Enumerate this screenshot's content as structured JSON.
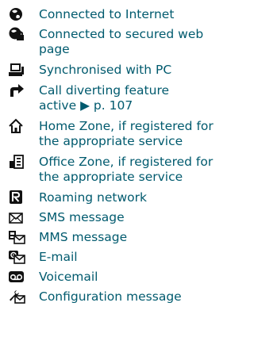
{
  "entries": [
    {
      "icon": "globe-connected-icon",
      "text": "Connected to Internet"
    },
    {
      "icon": "secured-globe-icon",
      "text": "Connected to secured web\npage"
    },
    {
      "icon": "pc-sync-icon",
      "text": "Synchronised with PC"
    },
    {
      "icon": "call-divert-arrow-icon",
      "text": "Call diverting feature\nactive",
      "ref": "p. 107"
    },
    {
      "icon": "home-zone-icon",
      "text": "Home Zone, if registered for\nthe appropriate service"
    },
    {
      "icon": "office-zone-icon",
      "text": "Office Zone, if registered for\nthe appropriate service"
    },
    {
      "icon": "roaming-r-icon",
      "text": "Roaming network"
    },
    {
      "icon": "sms-envelope-icon",
      "text": "SMS message"
    },
    {
      "icon": "mms-icon",
      "text": "MMS message"
    },
    {
      "icon": "email-icon",
      "text": "E-mail"
    },
    {
      "icon": "voicemail-icon",
      "text": "Voicemail"
    },
    {
      "icon": "config-message-icon",
      "text": "Configuration message"
    }
  ]
}
